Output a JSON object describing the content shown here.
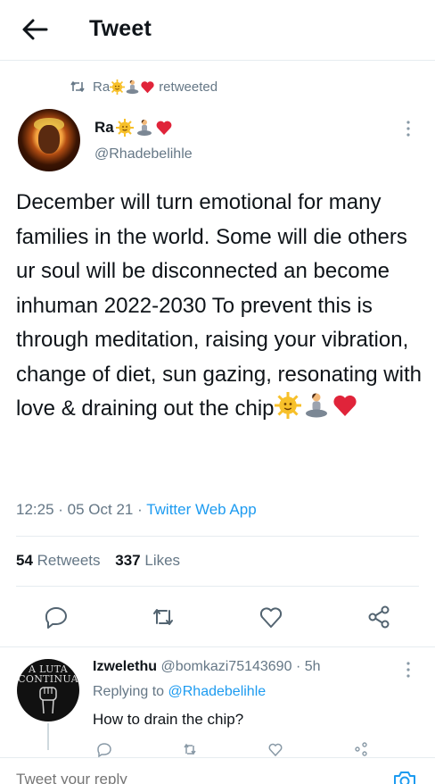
{
  "header": {
    "title": "Tweet"
  },
  "retweet": {
    "by_name": "Ra",
    "label": "retweeted"
  },
  "tweet": {
    "author_name": "Ra",
    "author_handle": "@Rhadebelihle",
    "text": "December will turn emotional for many families in the world. Some will die others ur soul will be disconnected an become inhuman 2022-2030 To prevent this is through meditation, raising your vibration, change of diet, sun gazing, resonating with love & draining out the chip",
    "emojis": [
      "sun-face",
      "person-meditating",
      "red-heart"
    ],
    "time": "12:25",
    "date": "05 Oct 21",
    "source": "Twitter Web App",
    "retweets_count": "54",
    "retweets_label": "Retweets",
    "likes_count": "337",
    "likes_label": "Likes"
  },
  "reply": {
    "avatar_text_1": "A LUTA",
    "avatar_text_2": "CONTINUA",
    "name": "Izwelethu",
    "handle": "@bomkazi75143690",
    "age": "5h",
    "replying_prefix": "Replying to",
    "replying_to": "@Rhadebelihle",
    "text": "How to drain the chip?"
  },
  "compose": {
    "placeholder": "Tweet your reply"
  },
  "colors": {
    "accent": "#1d9bf0",
    "muted": "#657786",
    "text": "#0f1419",
    "heart": "#e0243a",
    "sun": "#f7c02a"
  }
}
